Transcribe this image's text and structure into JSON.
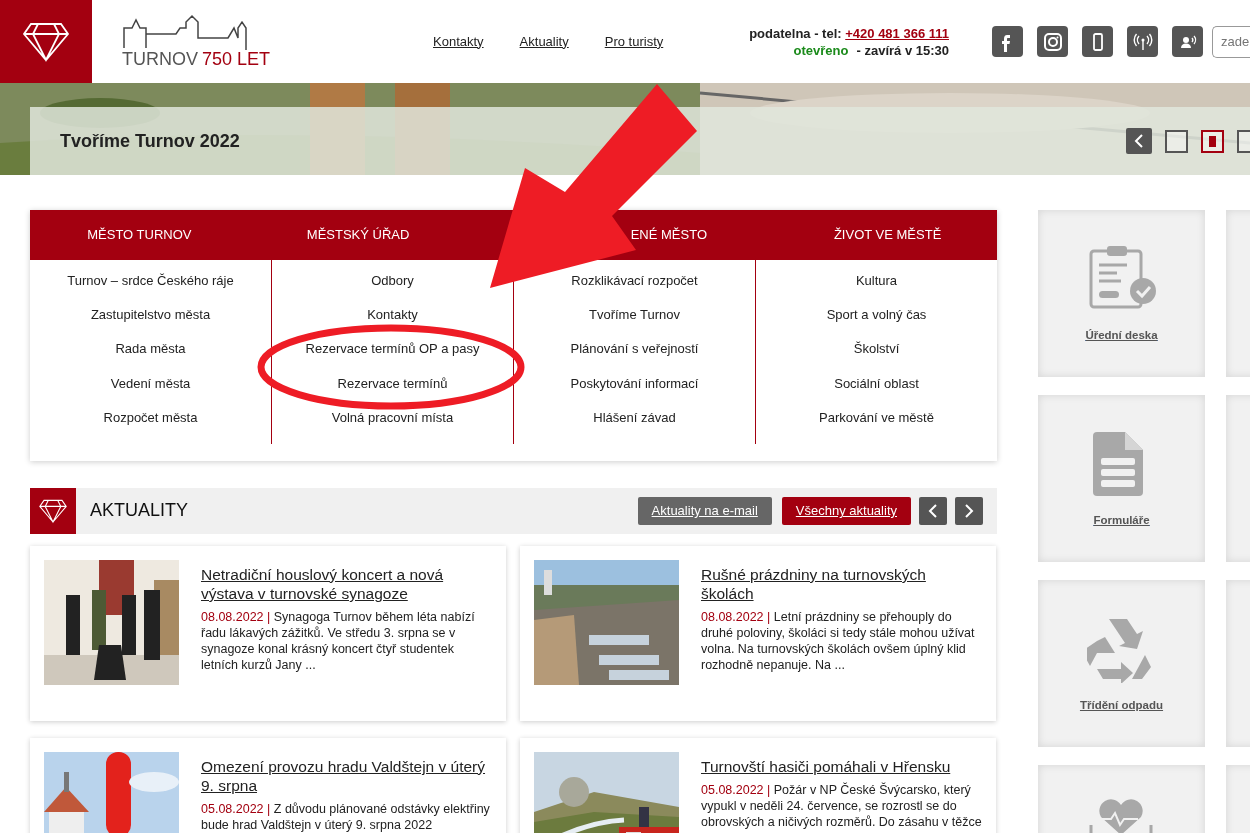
{
  "header": {
    "logo": {
      "town": "TURNOV",
      "years": "750 LET"
    },
    "nav_links": [
      "Kontakty",
      "Aktuality",
      "Pro turisty"
    ],
    "contact": {
      "label": "podatelna - tel:",
      "phone": "+420 481 366 111",
      "status": "otevřeno",
      "hours": "- zavírá v 15:30"
    },
    "search": {
      "placeholder": "zade"
    }
  },
  "banner": {
    "title": "Tvoříme Turnov 2022",
    "slides": [
      {
        "selected": false
      },
      {
        "selected": true
      },
      {
        "selected": false
      }
    ]
  },
  "menu": {
    "columns": [
      {
        "heading": "MĚSTO TURNOV",
        "items": [
          "Turnov – srdce Českého ráje",
          "Zastupitelstvo města",
          "Rada města",
          "Vedení města",
          "Rozpočet města"
        ]
      },
      {
        "heading": "MĚSTSKÝ ÚŘAD",
        "items": [
          "Odbory",
          "Kontakty",
          "Rezervace termínů OP a pasy",
          "Rezervace termínů",
          "Volná pracovní místa"
        ]
      },
      {
        "heading": "ENÉ MĚSTO",
        "items": [
          "Rozklikávací rozpočet",
          "Tvoříme Turnov",
          "Plánování s veřejností",
          "Poskytování informací",
          "Hlášení závad"
        ]
      },
      {
        "heading": "ŽIVOT VE MĚSTĚ",
        "items": [
          "Kultura",
          "Sport a volný čas",
          "Školství",
          "Sociální oblast",
          "Parkování ve městě"
        ]
      }
    ]
  },
  "news": {
    "title": "AKTUALITY",
    "separator": "|",
    "buttons": [
      {
        "label": "Aktuality na e-mail",
        "kind": "secondary"
      },
      {
        "label": "Všechny aktuality",
        "kind": "primary"
      }
    ],
    "articles": [
      {
        "title": "Netradiční houslový koncert a nová výstava v turnovské synagoze",
        "date": "08.08.2022",
        "text": "Synagoga Turnov během léta nabízí řadu lákavých zážitků. Ve středu 3. srpna se v synagoze konal krásný koncert čtyř studentek letních kurzů Jany ..."
      },
      {
        "title": "Rušné prázdniny na turnovských školách",
        "date": "08.08.2022",
        "text": "Letní prázdniny se přehouply do druhé poloviny, školáci si tedy stále mohou užívat volna. Na turnovských školách ovšem úplný klid rozhodně nepanuje. Na ..."
      },
      {
        "title": "Omezení provozu hradu Valdštejn v úterý 9. srpna",
        "date": "05.08.2022",
        "text": "Z důvodu plánované odstávky elektřiny bude hrad Valdštejn v úterý 9. srpna 2022"
      },
      {
        "title": "Turnovští hasiči pomáhali v Hřensku",
        "date": "05.08.2022",
        "text": "Požár v NP České Švýcarsko, který vypukl v neděli 24. července, se rozrostl se do obrovských a ničivých rozměrů. Do zásahu v těžce"
      }
    ]
  },
  "tiles": [
    {
      "kind": "board",
      "label": "Úřední deska"
    },
    {
      "kind": "form",
      "label": "Formuláře"
    },
    {
      "kind": "recycle",
      "label": "Třídění odpadu"
    },
    {
      "kind": "health"
    }
  ],
  "annotations": {
    "arrow": {
      "color": "#ee1c25"
    },
    "ellipse": {
      "color": "#ee1c25"
    }
  }
}
